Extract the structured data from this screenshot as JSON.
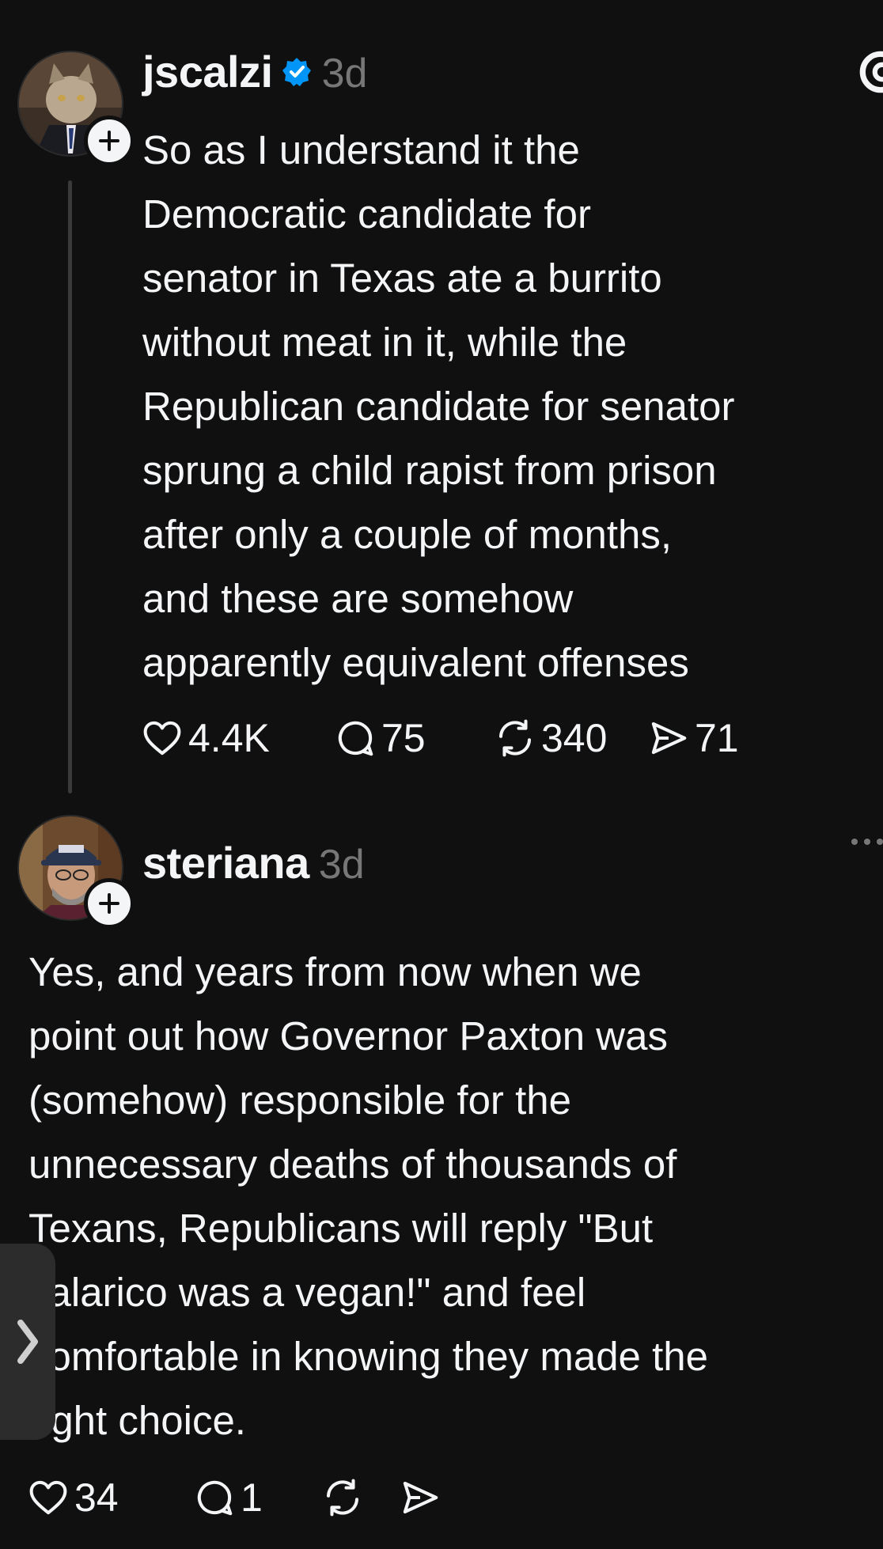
{
  "posts": [
    {
      "username": "jscalzi",
      "verified": true,
      "time": "3d",
      "text_lines": [
        "So as I understand it the",
        "Democratic candidate for",
        "senator in Texas ate a burrito",
        "without meat in it, while the",
        "Republican candidate for senator",
        "sprung a child rapist from prison",
        "after only a couple of months,",
        "and these are somehow",
        "apparently equivalent offenses"
      ],
      "likes": "4.4K",
      "replies": "75",
      "reposts": "340",
      "shares": "71"
    },
    {
      "username": "steriana",
      "verified": false,
      "time": "3d",
      "text_lines": [
        "Yes, and years from now when we",
        "point out how Governor Paxton was",
        "(somehow) responsible for the",
        "unnecessary deaths of thousands of",
        "Texans, Republicans will reply \"But",
        "Talarico was a vegan!\" and feel",
        "comfortable in knowing they made the",
        "right choice."
      ],
      "likes": "34",
      "replies": "1",
      "reposts": "",
      "shares": ""
    }
  ],
  "icons": {
    "verified": "verified-badge-icon",
    "follow": "plus-icon",
    "like": "heart-icon",
    "reply": "comment-icon",
    "repost": "repost-icon",
    "share": "send-icon",
    "top_right": "threads-logo-icon",
    "more": "more-dots-icon",
    "side_tab": "chevron-right-icon"
  },
  "colors": {
    "background": "#101010",
    "text": "#f3f5f7",
    "muted": "#777777",
    "verified": "#0095f6"
  }
}
